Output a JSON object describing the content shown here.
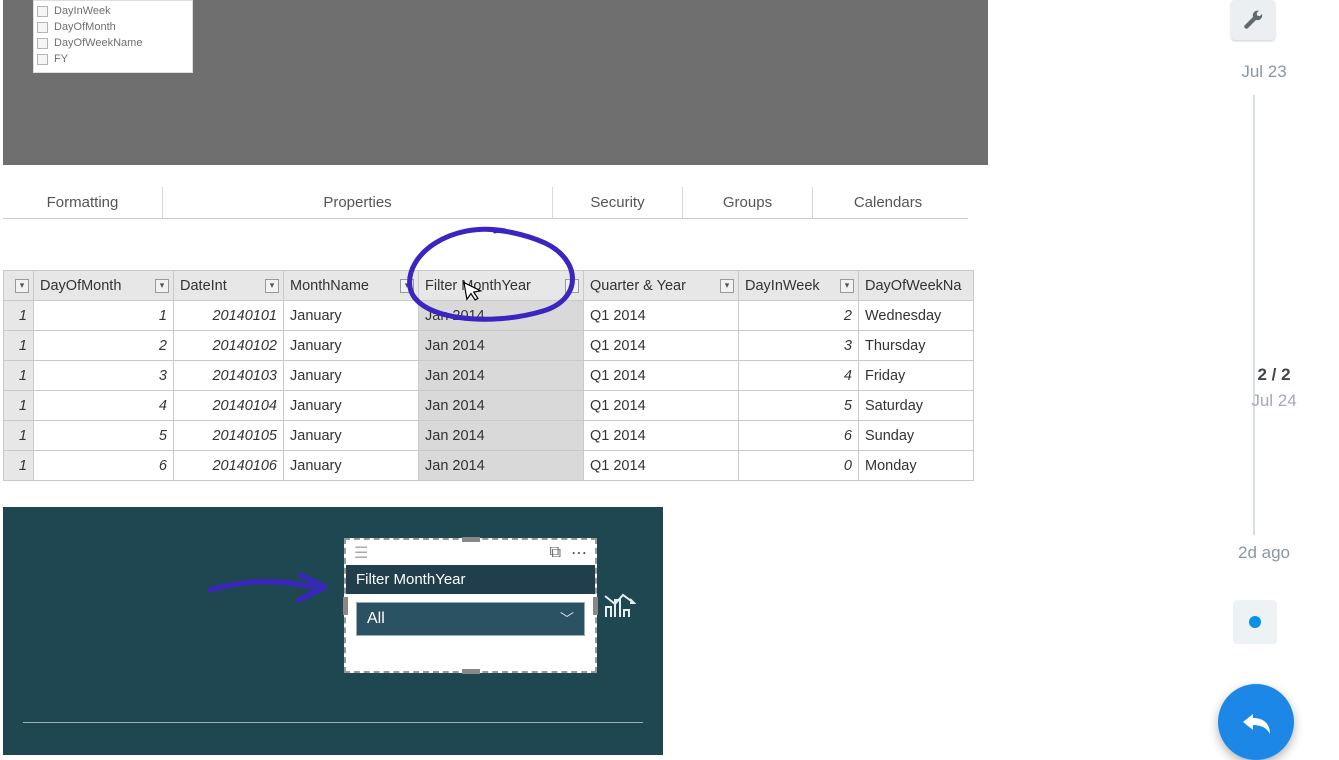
{
  "fieldlist": {
    "items": [
      {
        "label": "DayInWeek"
      },
      {
        "label": "DayOfMonth"
      },
      {
        "label": "DayOfWeekName"
      },
      {
        "label": "FY"
      }
    ]
  },
  "ribbon": {
    "formatting": "Formatting",
    "properties": "Properties",
    "security": "Security",
    "groups": "Groups",
    "calendars": "Calendars"
  },
  "table": {
    "columns": {
      "dom": "DayOfMonth",
      "dint": "DateInt",
      "mname": "MonthName",
      "fmy": "Filter MonthYear",
      "qy": "Quarter & Year",
      "dow": "DayInWeek",
      "down": "DayOfWeekNa"
    },
    "rows": [
      {
        "idx": "1",
        "dom": "1",
        "dint": "20140101",
        "mname": "January",
        "fmy": "Jan 2014",
        "qy": "Q1 2014",
        "dow": "2",
        "down": "Wednesday"
      },
      {
        "idx": "1",
        "dom": "2",
        "dint": "20140102",
        "mname": "January",
        "fmy": "Jan 2014",
        "qy": "Q1 2014",
        "dow": "3",
        "down": "Thursday"
      },
      {
        "idx": "1",
        "dom": "3",
        "dint": "20140103",
        "mname": "January",
        "fmy": "Jan 2014",
        "qy": "Q1 2014",
        "dow": "4",
        "down": "Friday"
      },
      {
        "idx": "1",
        "dom": "4",
        "dint": "20140104",
        "mname": "January",
        "fmy": "Jan 2014",
        "qy": "Q1 2014",
        "dow": "5",
        "down": "Saturday"
      },
      {
        "idx": "1",
        "dom": "5",
        "dint": "20140105",
        "mname": "January",
        "fmy": "Jan 2014",
        "qy": "Q1 2014",
        "dow": "6",
        "down": "Sunday"
      },
      {
        "idx": "1",
        "dom": "6",
        "dint": "20140106",
        "mname": "January",
        "fmy": "Jan 2014",
        "qy": "Q1 2014",
        "dow": "0",
        "down": "Monday"
      }
    ]
  },
  "slicer": {
    "title": "Filter MonthYear",
    "value": "All"
  },
  "timeline": {
    "topDate": "Jul 23",
    "counter": "2 / 2",
    "midDate": "Jul 24",
    "bottomDate": "2d ago"
  },
  "annotations": {
    "circleColor": "#3a25c2",
    "arrowColor": "#3a25c2"
  }
}
